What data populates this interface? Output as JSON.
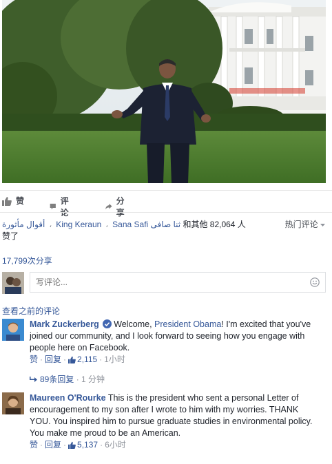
{
  "post": {
    "actions": {
      "like": "赞",
      "comment": "评论",
      "share": "分享"
    },
    "likes": {
      "name1": "أقوال مأثورة",
      "name2": "King Keraun",
      "name3": "Sana Safi ثنا صافی",
      "rest": "和其他 82,064 人",
      "line2": "赞了",
      "sort_label": "热门评论"
    },
    "shares": "17,799次分享",
    "composer": {
      "placeholder": "写评论..."
    },
    "view_previous": "查看之前的评论"
  },
  "comments": [
    {
      "author": "Mark Zuckerberg",
      "verified": true,
      "text_before": "Welcome, ",
      "mention": "President Obama",
      "text_after": "! I'm excited that you've joined our community, and I look forward to seeing how you engage with people here on Facebook.",
      "like_label": "赞",
      "reply_label": "回复",
      "like_count": "2,115",
      "time": "1小时",
      "replies_label": "89条回复",
      "replies_time": "1 分钟"
    },
    {
      "author": "Maureen O'Rourke",
      "text": "This is the president who sent a personal Letter of encouragement to my son after I wrote to him with my worries. THANK YOU. You inspired him to pursue graduate studies in environmental policy.",
      "text2": "You make me proud to be an American.",
      "like_label": "赞",
      "reply_label": "回复",
      "like_count": "5,137",
      "time": "6小时"
    }
  ],
  "colors": {
    "link": "#365899",
    "muted": "#90949c",
    "text": "#1d2129"
  }
}
